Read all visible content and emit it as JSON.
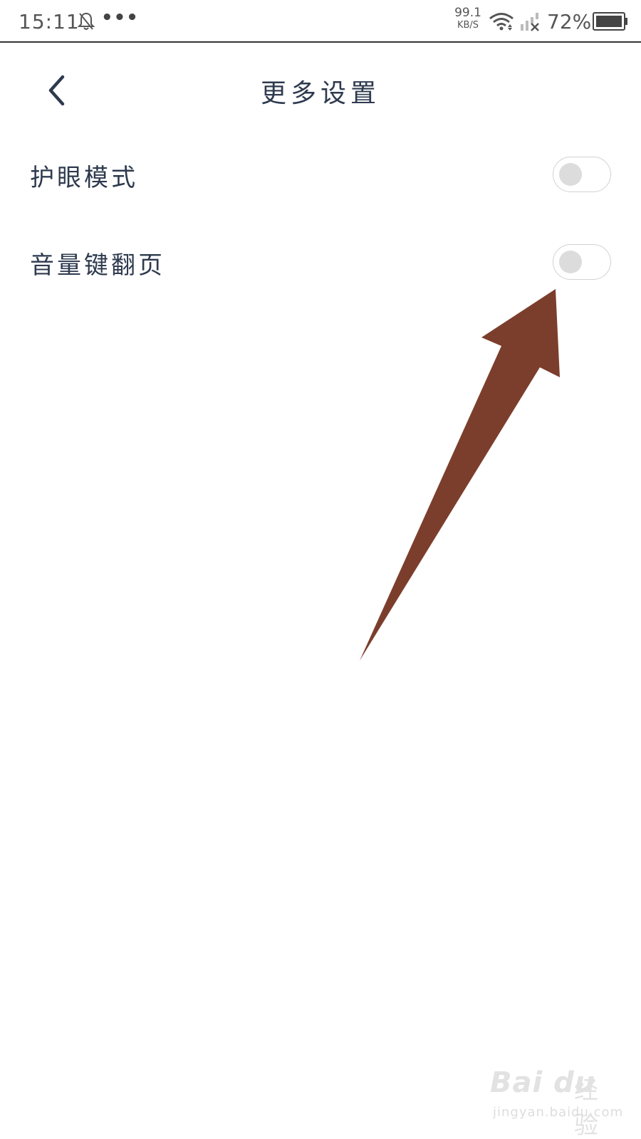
{
  "status_bar": {
    "time": "15:11",
    "dots": "•••",
    "net_speed_value": "99.1",
    "net_speed_unit": "KB/S",
    "battery_percent": "72%"
  },
  "header": {
    "title": "更多设置"
  },
  "settings": [
    {
      "label": "护眼模式",
      "enabled": false
    },
    {
      "label": "音量键翻页",
      "enabled": false
    }
  ],
  "colors": {
    "text_primary": "#2e3a4e",
    "toggle_border": "#d2d2d2",
    "toggle_knob": "#dcdcdc",
    "annotation_arrow": "#7c3e2c"
  },
  "watermark": {
    "logo": "Bai du",
    "cn": "经验",
    "url": "jingyan.baidu.com"
  }
}
